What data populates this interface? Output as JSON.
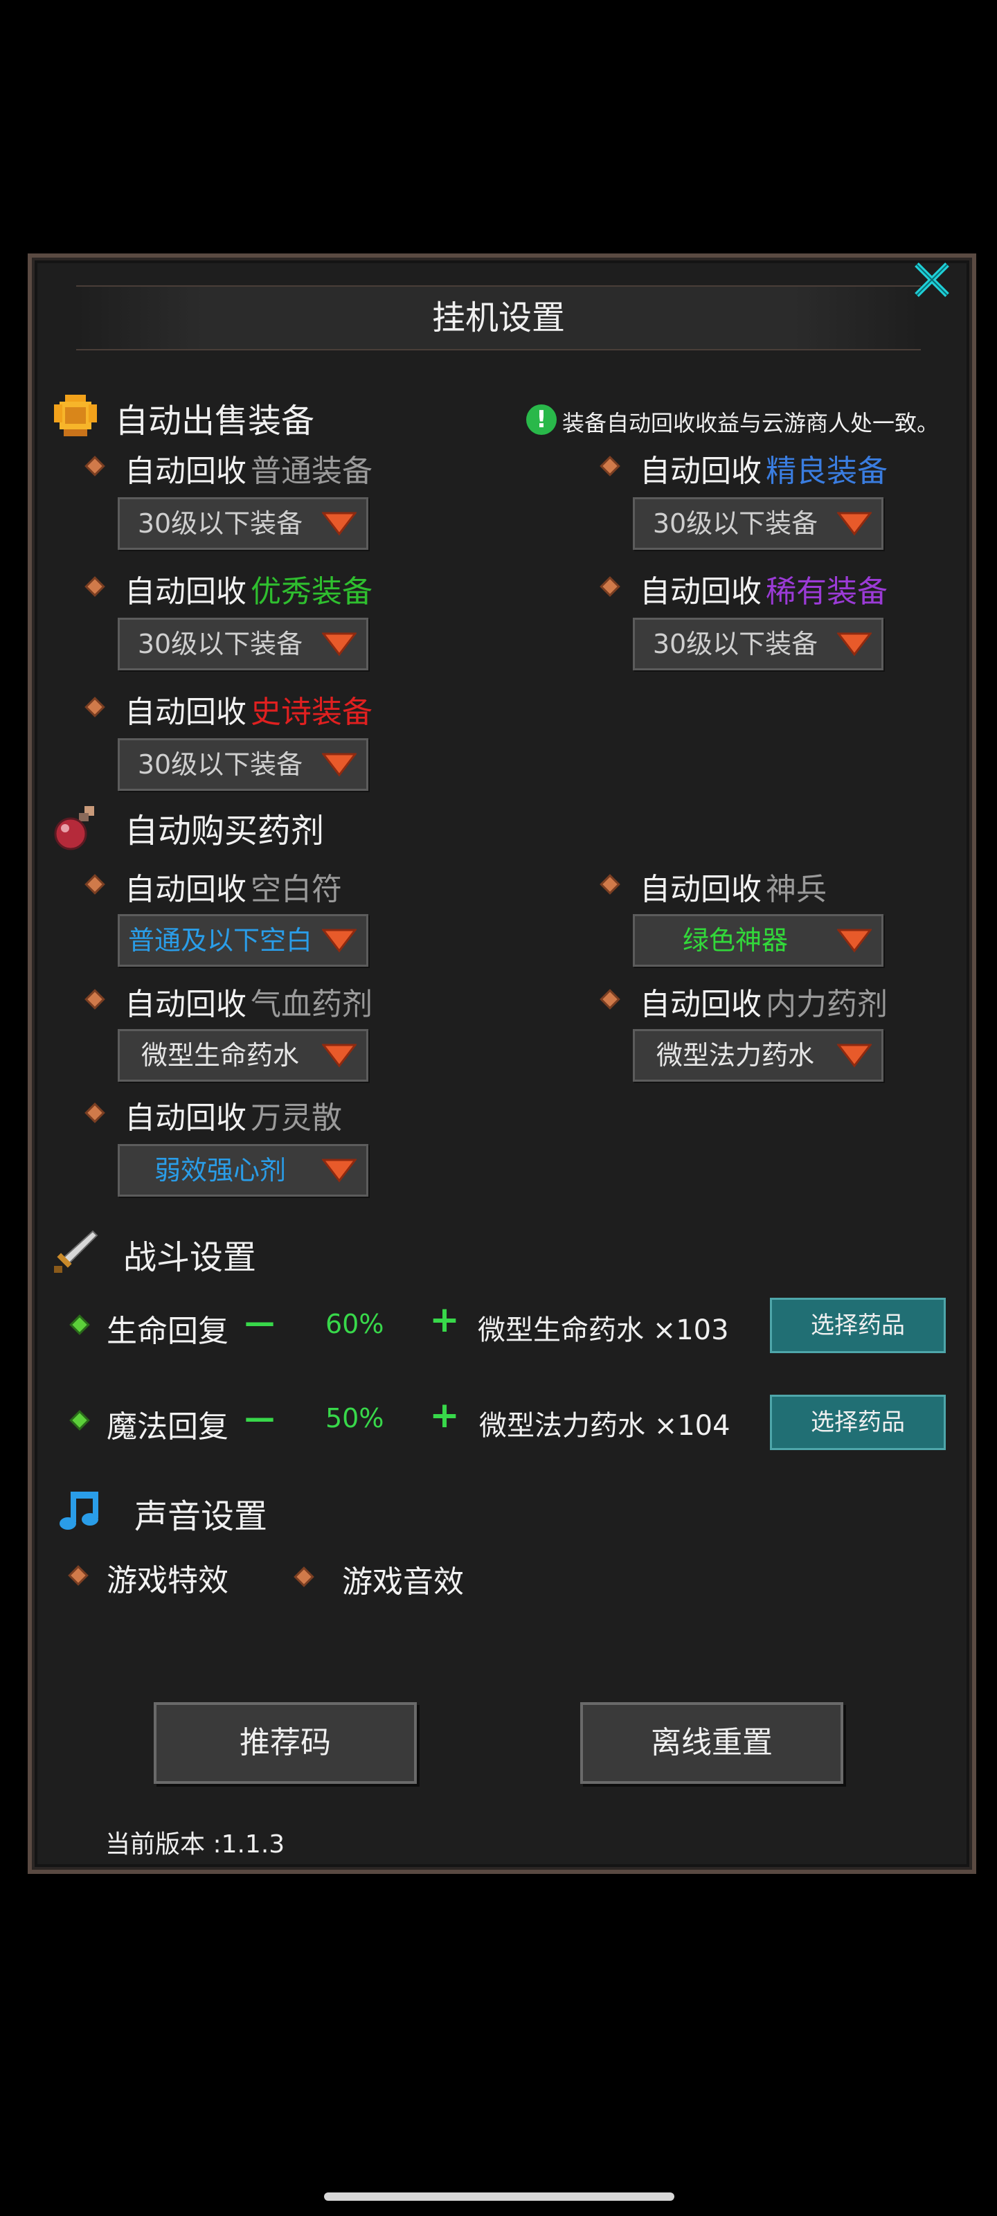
{
  "title": "挂机设置",
  "sell": {
    "title": "自动出售装备",
    "note": "装备自动回收收益与云游商人处一致。",
    "prefix": "自动回收",
    "items": [
      {
        "quality": "普通装备",
        "color": "#9a9a9a",
        "value": "30级以下装备"
      },
      {
        "quality": "精良装备",
        "color": "#3a7de0",
        "value": "30级以下装备"
      },
      {
        "quality": "优秀装备",
        "color": "#2fbf2f",
        "value": "30级以下装备"
      },
      {
        "quality": "稀有装备",
        "color": "#9b3bd6",
        "value": "30级以下装备"
      },
      {
        "quality": "史诗装备",
        "color": "#e02020",
        "value": "30级以下装备"
      }
    ]
  },
  "buy": {
    "title": "自动购买药剂",
    "prefix": "自动回收",
    "items": [
      {
        "name": "空白符",
        "value": "普通及以下空白",
        "value_color": "#2a9de8"
      },
      {
        "name": "神兵",
        "value": "绿色神器",
        "value_color": "#32d83a"
      },
      {
        "name": "气血药剂",
        "value": "微型生命药水",
        "value_color": "#e6e6e6"
      },
      {
        "name": "内力药剂",
        "value": "微型法力药水",
        "value_color": "#e6e6e6"
      },
      {
        "name": "万灵散",
        "value": "弱效强心剂",
        "value_color": "#2a9de8"
      }
    ]
  },
  "combat": {
    "title": "战斗设置",
    "rows": [
      {
        "label": "生命回复",
        "minus": "—",
        "percent": "60%",
        "plus": "+",
        "potion": "微型生命药水 ×103",
        "button": "选择药品"
      },
      {
        "label": "魔法回复",
        "minus": "—",
        "percent": "50%",
        "plus": "+",
        "potion": "微型法力药水 ×104",
        "button": "选择药品"
      }
    ]
  },
  "sound": {
    "title": "声音设置",
    "effects": "游戏特效",
    "audio": "游戏音效"
  },
  "buttons": {
    "referral": "推荐码",
    "offline_reset": "离线重置"
  },
  "version": "当前版本 :1.1.3",
  "icons": {
    "close": "close-icon",
    "sell": "gold-armor-icon",
    "buy": "potion-flask-icon",
    "combat": "sword-icon",
    "sound": "music-note-icon",
    "note": "exclamation-icon",
    "bullet": "diamond-bullet-icon",
    "dropdown": "triangle-down-icon"
  }
}
